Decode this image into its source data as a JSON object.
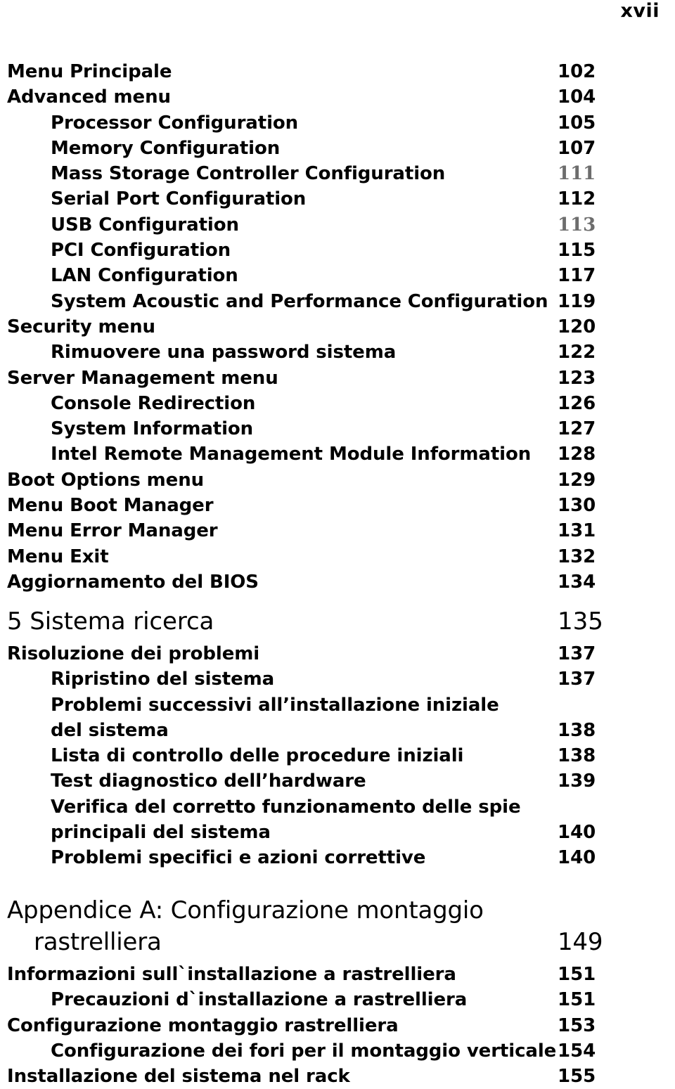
{
  "folio": "xvii",
  "sections": [
    {
      "id": "bios",
      "entries": [
        {
          "label": "Menu Principale",
          "page": "102",
          "level": 0
        },
        {
          "label": "Advanced menu",
          "page": "104",
          "level": 0
        },
        {
          "label": "Processor Configuration",
          "page": "105",
          "level": 1
        },
        {
          "label": "Memory Configuration",
          "page": "107",
          "level": 1
        },
        {
          "label": "Mass Storage Controller Configuration",
          "page": "111",
          "level": 1,
          "num_style": "serif"
        },
        {
          "label": "Serial Port Configuration",
          "page": "112",
          "level": 1
        },
        {
          "label": "USB Configuration",
          "page": "113",
          "level": 1,
          "num_style": "serif"
        },
        {
          "label": "PCI Configuration",
          "page": "115",
          "level": 1
        },
        {
          "label": "LAN Configuration",
          "page": "117",
          "level": 1
        },
        {
          "label": "System Acoustic and Performance Configuration",
          "page": "119",
          "level": 1
        },
        {
          "label": "Security menu",
          "page": "120",
          "level": 0
        },
        {
          "label": "Rimuovere una password sistema",
          "page": "122",
          "level": 1
        },
        {
          "label": "Server Management menu",
          "page": "123",
          "level": 0
        },
        {
          "label": "Console Redirection",
          "page": "126",
          "level": 1
        },
        {
          "label": "System Information",
          "page": "127",
          "level": 1
        },
        {
          "label": "Intel Remote Management Module Information",
          "page": "128",
          "level": 1
        },
        {
          "label": "Boot Options menu",
          "page": "129",
          "level": 0
        },
        {
          "label": "Menu Boot Manager",
          "page": "130",
          "level": 0
        },
        {
          "label": "Menu Error Manager",
          "page": "131",
          "level": 0
        },
        {
          "label": "Menu Exit",
          "page": "132",
          "level": 0
        },
        {
          "label": "Aggiornamento del BIOS",
          "page": "134",
          "level": 0
        }
      ]
    },
    {
      "id": "chap5",
      "chapter": {
        "label": "5 Sistema ricerca",
        "page": "135"
      },
      "entries": [
        {
          "label": "Risoluzione dei problemi",
          "page": "137",
          "level": 0
        },
        {
          "label": "Ripristino del sistema",
          "page": "137",
          "level": 1
        },
        {
          "label": "Problemi successivi all’installazione iniziale",
          "page": "",
          "level": 1
        },
        {
          "label": "del sistema",
          "page": "138",
          "level": 1,
          "continuation": true
        },
        {
          "label": "Lista di controllo delle procedure iniziali",
          "page": "138",
          "level": 1
        },
        {
          "label": "Test diagnostico dell’hardware",
          "page": "139",
          "level": 1
        },
        {
          "label": "Verifica del corretto funzionamento delle spie",
          "page": "",
          "level": 1
        },
        {
          "label": "principali del sistema",
          "page": "140",
          "level": 1,
          "continuation": true
        },
        {
          "label": "Problemi specifici e azioni correttive",
          "page": "140",
          "level": 1
        }
      ]
    },
    {
      "id": "appA",
      "appendix": {
        "line1": "Appendice A:  Configurazione montaggio",
        "line2": "rastrelliera",
        "page": "149"
      },
      "entries": [
        {
          "label": "Informazioni sull`installazione a rastrelliera",
          "page": "151",
          "level": 0
        },
        {
          "label": "Precauzioni d`installazione a rastrelliera",
          "page": "151",
          "level": 1
        },
        {
          "label": "Configurazione montaggio rastrelliera",
          "page": "153",
          "level": 0
        },
        {
          "label": "Configurazione dei fori per il montaggio verticale",
          "page": "154",
          "level": 1
        },
        {
          "label": "Installazione del sistema nel rack",
          "page": "155",
          "level": 0
        }
      ]
    }
  ]
}
